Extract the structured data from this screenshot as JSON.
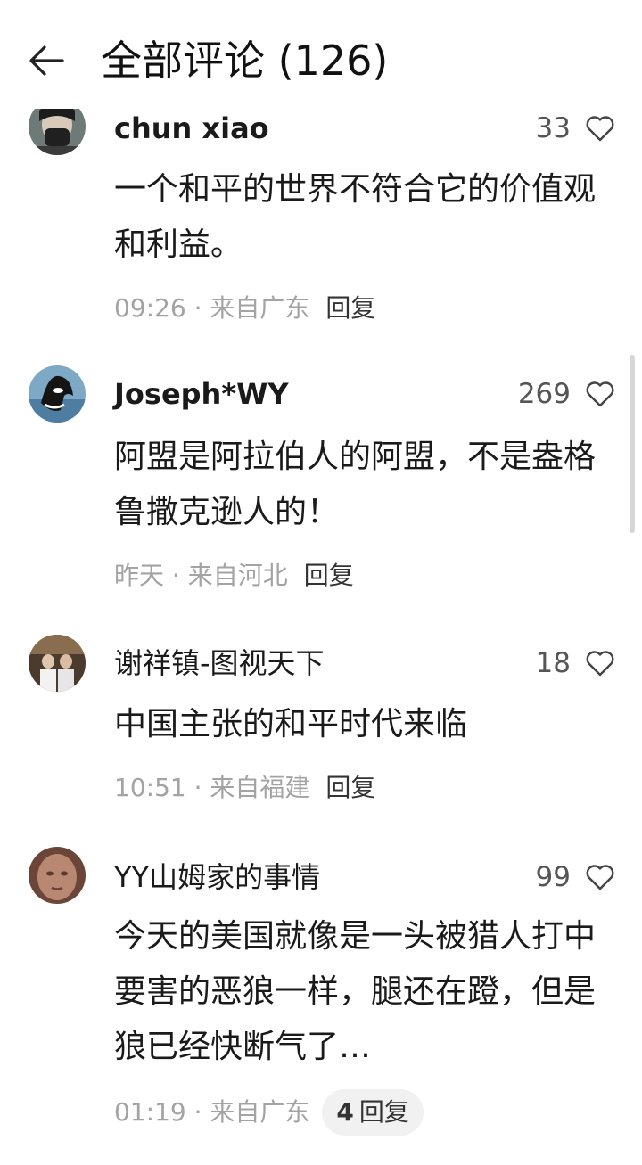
{
  "header": {
    "title": "全部评论 (126)",
    "back_icon": "arrow-left-icon"
  },
  "comments": [
    {
      "username": "chun xiao",
      "likes": "33",
      "content": "一个和平的世界不符合它的价值观和利益。",
      "time": "09:26",
      "location": "来自广东",
      "reply_label": "回复"
    },
    {
      "username": "Joseph*WY",
      "likes": "269",
      "content": "阿盟是阿拉伯人的阿盟，不是盎格鲁撒克逊人的！",
      "time": "昨天",
      "location": "来自河北",
      "reply_label": "回复"
    },
    {
      "username": "谢祥镇-图视天下",
      "likes": "18",
      "content": "中国主张的和平时代来临",
      "time": "10:51",
      "location": "来自福建",
      "reply_label": "回复"
    },
    {
      "username": "YY山姆家的事情",
      "likes": "99",
      "content": "今天的美国就像是一头被猎人打中要害的恶狼一样，腿还在蹬，但是狼已经快断气了…",
      "time": "01:19",
      "location": "来自广东",
      "reply_count": "4",
      "reply_label": "回复"
    }
  ],
  "icons": {
    "like": "heart-outline-icon",
    "avatar": "avatar"
  },
  "colors": {
    "text": "#1a1a1a",
    "meta": "#a3a3a3",
    "reply_pill_bg": "#f1f1f1"
  }
}
